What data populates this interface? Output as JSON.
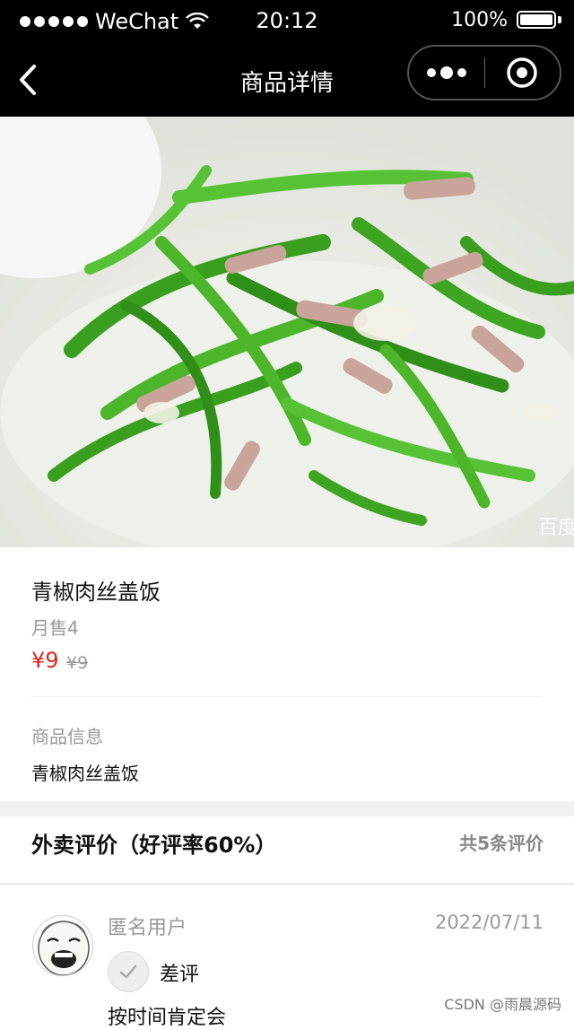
{
  "status_bar": {
    "carrier": "WeChat",
    "time": "20:12",
    "battery": "100%"
  },
  "nav": {
    "title": "商品详情",
    "icons": [
      "back-arrow-icon",
      "more-dots-icon",
      "close-circle-icon"
    ]
  },
  "product": {
    "name": "青椒肉丝盖饭",
    "monthly_sales": "月售4",
    "price": "¥9",
    "original_price": "¥9",
    "info_label": "商品信息",
    "info_value": "青椒肉丝盖饭",
    "image_watermark": "百度"
  },
  "reviews": {
    "title": "外卖评价（好评率60%）",
    "count": "共5条评价",
    "items": [
      {
        "user": "匿名用户",
        "date": "2022/07/11",
        "rating": "差评",
        "text": "按时间肯定会"
      }
    ]
  },
  "watermark": "CSDN @雨晨源码",
  "colors": {
    "price_red": "#e1251b",
    "nav_bg": "#000000",
    "muted_text": "#999999"
  }
}
